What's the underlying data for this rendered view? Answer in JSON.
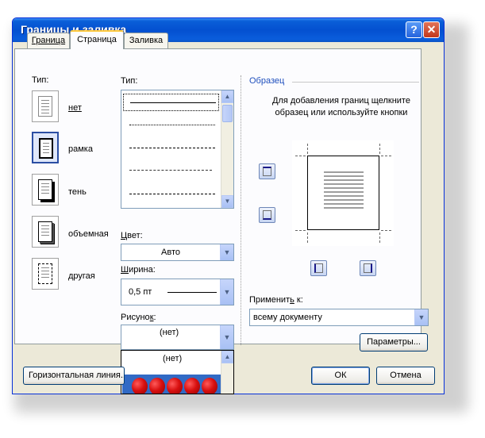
{
  "window": {
    "title": "Границы и заливка",
    "help_icon": "?",
    "close_icon": "✕"
  },
  "tabs": [
    {
      "label": "Граница",
      "active": false
    },
    {
      "label": "Страница",
      "active": true
    },
    {
      "label": "Заливка",
      "active": false
    }
  ],
  "settings": {
    "label": "Тип:",
    "items": [
      {
        "label": "нет",
        "selected": false
      },
      {
        "label": "рамка",
        "selected": true
      },
      {
        "label": "тень",
        "selected": false
      },
      {
        "label": "объемная",
        "selected": false
      },
      {
        "label": "другая",
        "selected": false
      }
    ]
  },
  "style": {
    "label": "Тип:",
    "items": [
      "solid",
      "dotted",
      "dashed-small",
      "dashed",
      "dash-dot"
    ],
    "selected_index": 0
  },
  "color": {
    "label": "Цвет:",
    "value": "Авто"
  },
  "width": {
    "label": "Ширина:",
    "value": "0,5 пт"
  },
  "art": {
    "label": "Рисунок:",
    "value": "(нет)",
    "dropdown_options": [
      "(нет)"
    ]
  },
  "preview": {
    "label": "Образец",
    "hint": "Для добавления границ щелкните образец или используйте кнопки"
  },
  "apply_to": {
    "label": "Применить к:",
    "value": "всему документу"
  },
  "buttons": {
    "options": "Параметры...",
    "horizontal_line": "Горизонтальная линия...",
    "ok": "ОК",
    "cancel": "Отмена"
  },
  "colors": {
    "title_bar": "#0450d0",
    "dialog_bg": "#ece9d8",
    "tab_highlight": "#ffc83c",
    "art_selection": "#316ac5"
  }
}
